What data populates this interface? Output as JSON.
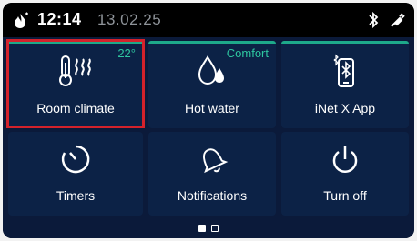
{
  "status_bar": {
    "time": "12:14",
    "date": "13.02.25",
    "left_icon": "flame-icon",
    "right_icons": [
      "bluetooth-icon",
      "plug-icon"
    ]
  },
  "tiles": [
    {
      "label": "Room climate",
      "icon": "thermometer-heat-icon",
      "badge": "22°",
      "selected": true
    },
    {
      "label": "Hot water",
      "icon": "water-drops-icon",
      "badge": "Comfort"
    },
    {
      "label": "iNet X App",
      "icon": "phone-bluetooth-icon"
    },
    {
      "label": "Timers",
      "icon": "timer-icon"
    },
    {
      "label": "Notifications",
      "icon": "bell-icon"
    },
    {
      "label": "Turn off",
      "icon": "power-icon"
    }
  ],
  "pagination": {
    "current_page": 1,
    "total_pages": 2
  },
  "colors": {
    "accent": "#1ea98a",
    "highlight_frame": "#d4222b",
    "tile_bg": "#0c2246",
    "screen_bg": "#0b1a3a"
  }
}
